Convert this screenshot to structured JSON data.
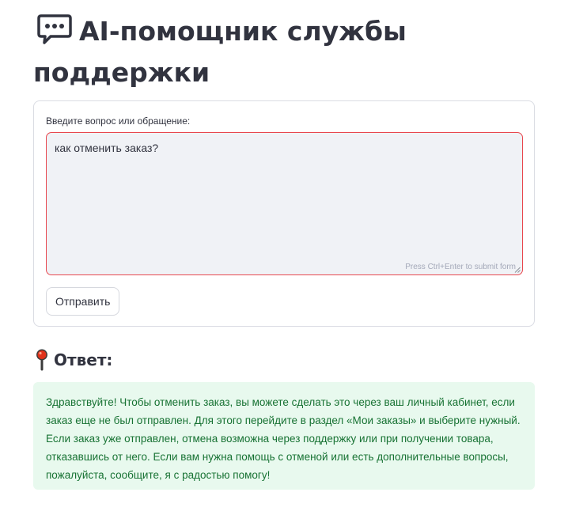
{
  "header": {
    "icon": "speech-bubble-icon",
    "title": "AI-помощник службы поддержки"
  },
  "form": {
    "label": "Введите вопрос или обращение:",
    "input_value": "как отменить заказ?",
    "submit_hint": "Press Ctrl+Enter to submit form",
    "submit_label": "Отправить"
  },
  "answer": {
    "icon": "round-pushpin-icon",
    "heading": "Ответ:",
    "text": "Здравствуйте! Чтобы отменить заказ, вы можете сделать это через ваш личный кабинет, если заказ еще не был отправлен. Для этого перейдите в раздел «Мои заказы» и выберите нужный. Если заказ уже отправлен, отмена возможна через поддержку или при получении товара, отказавшись от него. Если вам нужна помощь с отменой или есть дополнительные вопросы, пожалуйста, сообщите, я с радостью помогу!"
  },
  "colors": {
    "input_border_active": "#e8474e",
    "input_background": "#f0f2f6",
    "answer_background": "#e8f9ee",
    "answer_text": "#177233"
  }
}
